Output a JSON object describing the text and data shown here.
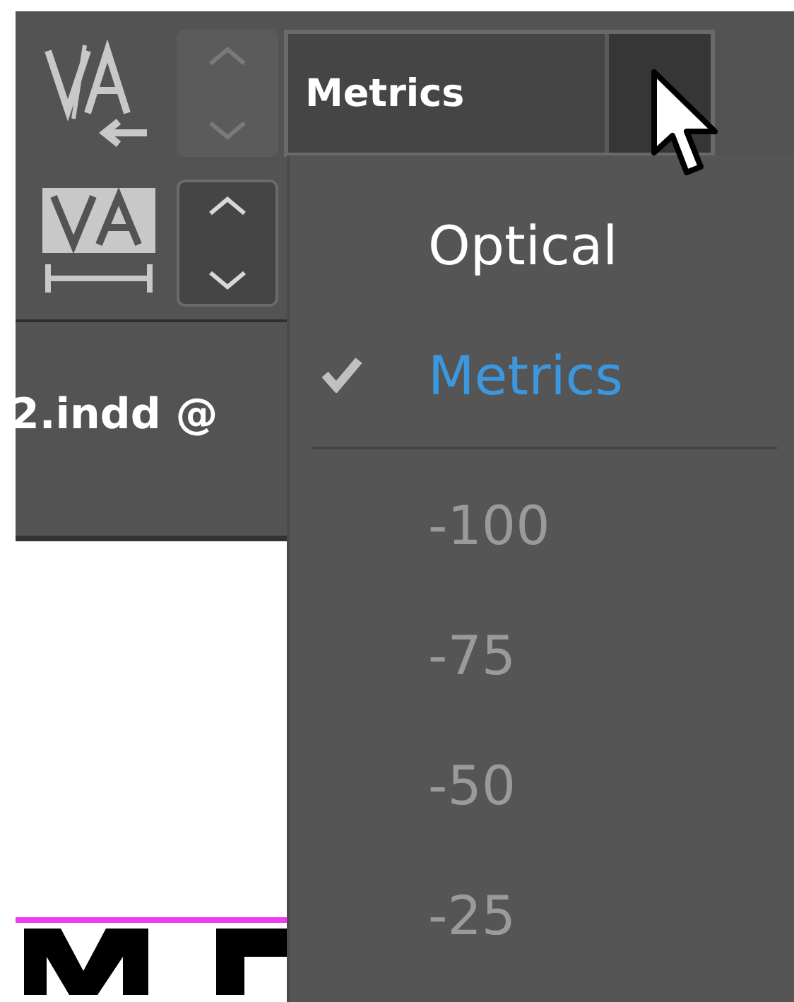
{
  "toolbar": {
    "kerning": {
      "stepper_disabled": true,
      "value": "Metrics"
    },
    "tracking": {
      "stepper_disabled": false
    }
  },
  "document_tab": {
    "title": "2.indd @"
  },
  "menu": {
    "items": [
      {
        "kind": "option",
        "label": "Optical",
        "selected": false,
        "disabled": false
      },
      {
        "kind": "option",
        "label": "Metrics",
        "selected": true,
        "disabled": false
      },
      {
        "kind": "separator"
      },
      {
        "kind": "option",
        "label": "-100",
        "selected": false,
        "disabled": true
      },
      {
        "kind": "option",
        "label": "-75",
        "selected": false,
        "disabled": true
      },
      {
        "kind": "option",
        "label": "-50",
        "selected": false,
        "disabled": true
      },
      {
        "kind": "option",
        "label": "-25",
        "selected": false,
        "disabled": true
      }
    ]
  }
}
